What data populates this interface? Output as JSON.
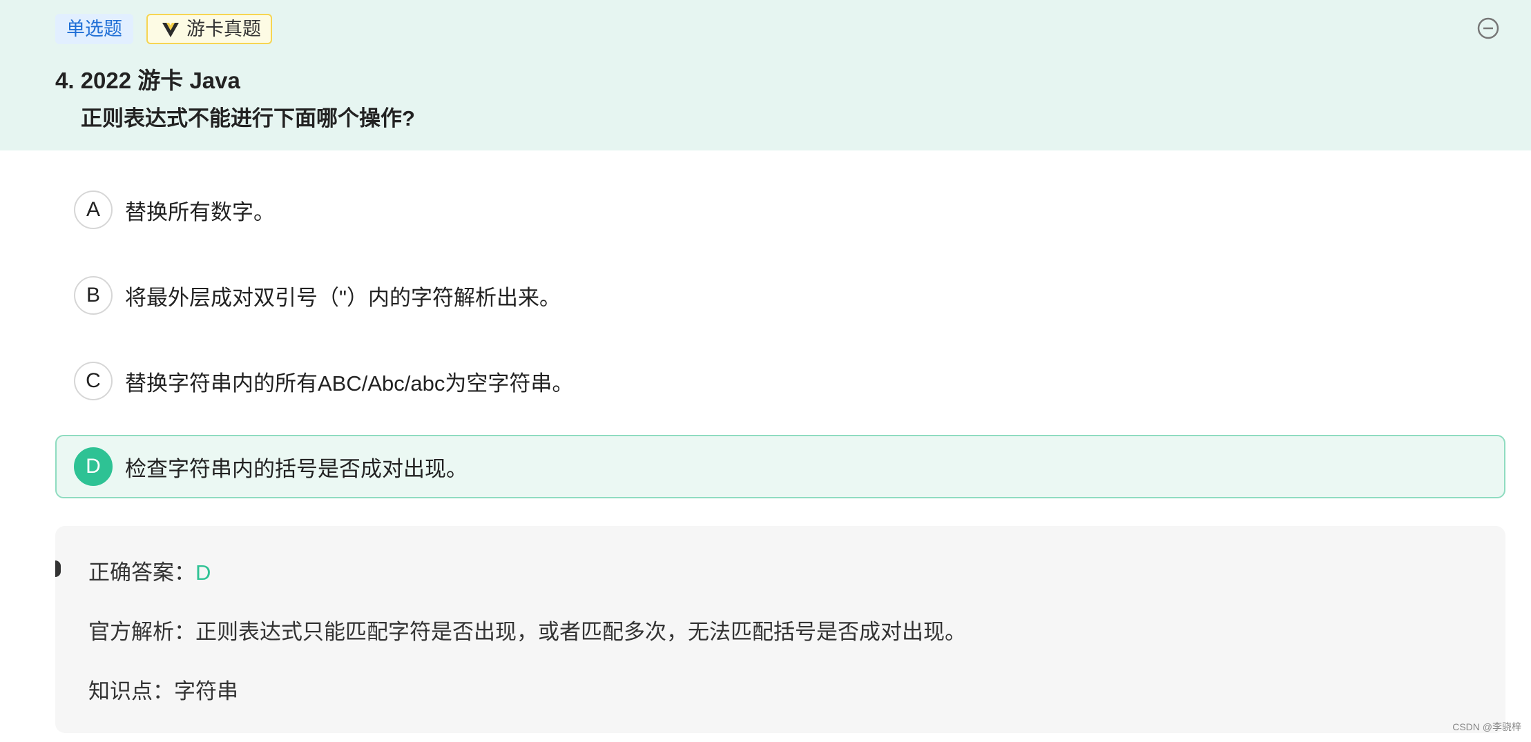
{
  "header": {
    "tag_type": "单选题",
    "tag_source": "游卡真题",
    "question_title": "4. 2022 游卡 Java",
    "question_text": "正则表达式不能进行下面哪个操作?"
  },
  "options": [
    {
      "letter": "A",
      "text": "替换所有数字。",
      "correct": false
    },
    {
      "letter": "B",
      "text": "将最外层成对双引号（\"）内的字符解析出来。",
      "correct": false
    },
    {
      "letter": "C",
      "text": "替换字符串内的所有ABC/Abc/abc为空字符串。",
      "correct": false
    },
    {
      "letter": "D",
      "text": "检查字符串内的括号是否成对出现。",
      "correct": true
    }
  ],
  "answer": {
    "correct_label": "正确答案：",
    "correct_value": "D",
    "analysis": "官方解析：正则表达式只能匹配字符是否出现，或者匹配多次，无法匹配括号是否成对出现。",
    "knowledge": "知识点：字符串"
  },
  "watermark": "CSDN @李骁梓",
  "colors": {
    "header_bg": "#e6f5f1",
    "accent_green": "#2ec294",
    "tag_blue": "#1f6fd6"
  },
  "icons": {
    "collapse": "minus-circle-icon",
    "source": "v-badge-icon"
  }
}
